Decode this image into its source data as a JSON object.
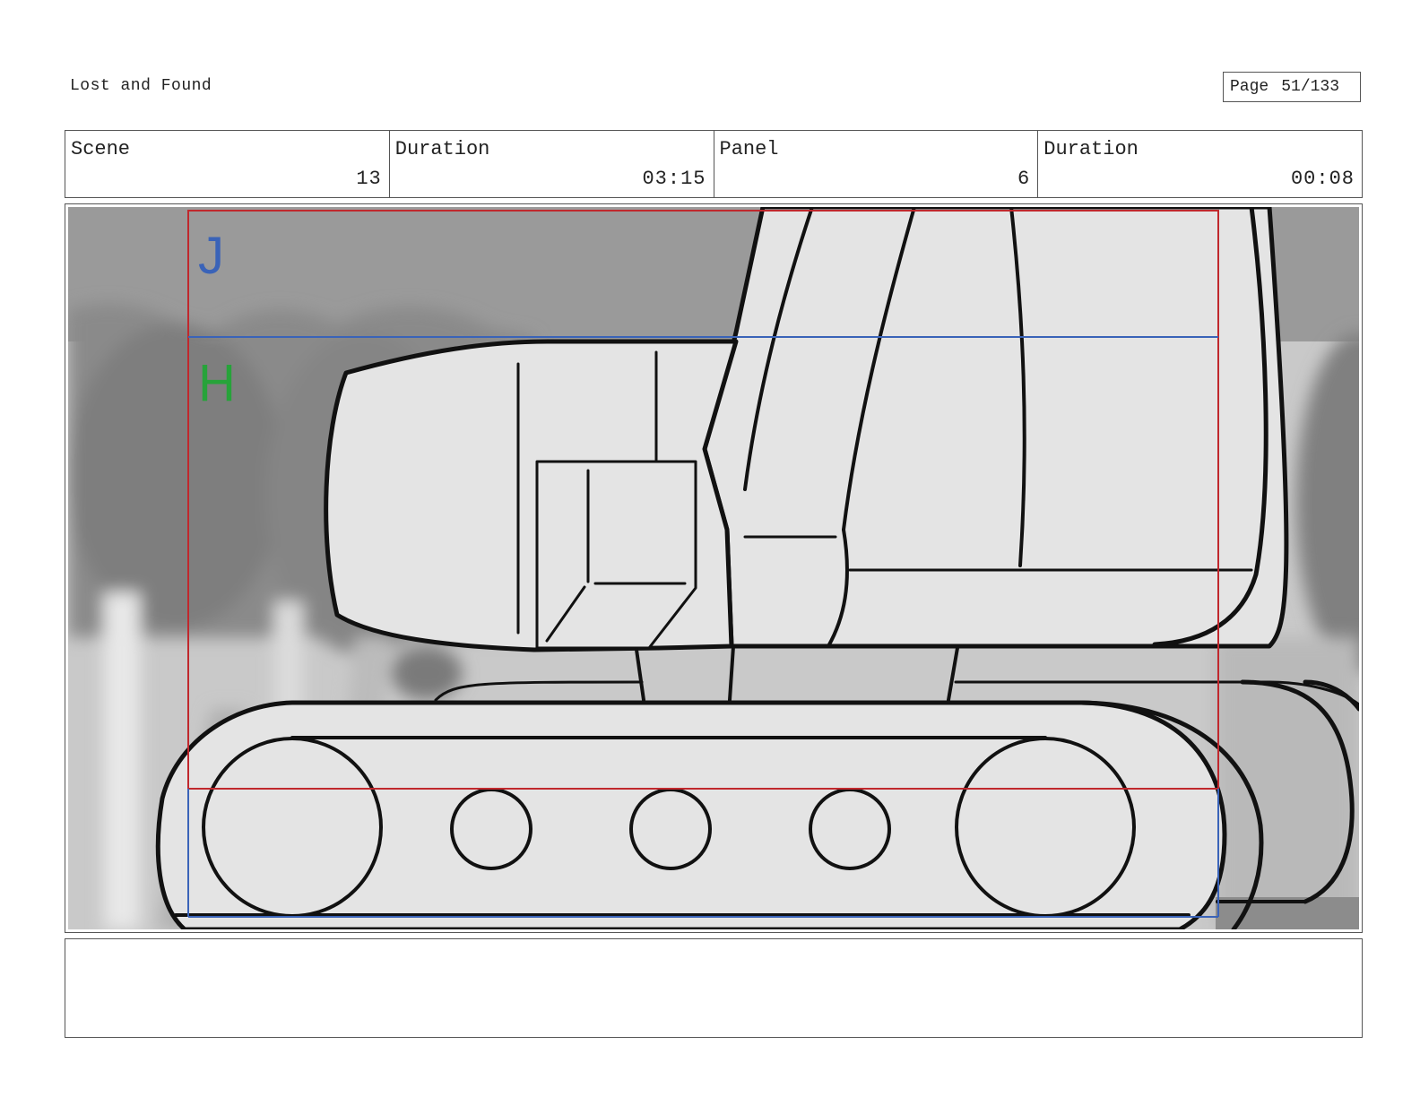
{
  "header": {
    "project_title": "Lost and Found",
    "page_label": "Page",
    "page_value": "51/133"
  },
  "info": {
    "scene_label": "Scene",
    "scene_value": "13",
    "scene_duration_label": "Duration",
    "scene_duration_value": "03:15",
    "panel_label": "Panel",
    "panel_value": "6",
    "panel_duration_label": "Duration",
    "panel_duration_value": "00:08"
  },
  "panel": {
    "safe_mark_top": "J",
    "safe_mark_inner": "H",
    "colors": {
      "frame_red": "#c0282d",
      "guide_blue": "#3a63b8",
      "mark_j": "#3a63b8",
      "mark_h": "#27a33a"
    }
  },
  "notes": {
    "text": ""
  }
}
